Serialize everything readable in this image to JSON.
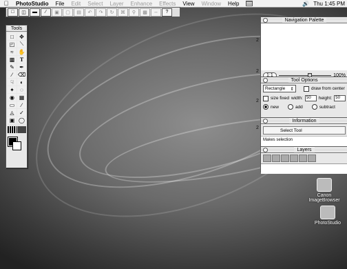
{
  "menubar": {
    "apple": "",
    "app_name": "PhotoStudio",
    "items": [
      {
        "label": "File",
        "enabled": true
      },
      {
        "label": "Edit",
        "enabled": false
      },
      {
        "label": "Select",
        "enabled": false
      },
      {
        "label": "Layer",
        "enabled": false
      },
      {
        "label": "Enhance",
        "enabled": false
      },
      {
        "label": "Effects",
        "enabled": false
      },
      {
        "label": "View",
        "enabled": true
      },
      {
        "label": "Window",
        "enabled": false
      },
      {
        "label": "Help",
        "enabled": true
      }
    ],
    "volume_icon": "speaker-icon",
    "clock": "Thu 1:45 PM"
  },
  "tools_palette": {
    "title": "Tools"
  },
  "toolbar": {
    "help_glyph": "?"
  },
  "navigation_palette": {
    "title": "Navigation Palette",
    "zoom_button": "1:1",
    "zoom_percent": "100%"
  },
  "tool_options": {
    "title": "Tool Options",
    "shape_select": "Rectangle",
    "draw_from_center": "draw from center",
    "size_fixed": "size fixed",
    "width_label": "width:",
    "width_value": "50",
    "height_label": "height:",
    "height_value": "50",
    "mode_new": "new",
    "mode_add": "add",
    "mode_subtract": "subtract"
  },
  "information": {
    "title": "Information",
    "button": "Select Tool",
    "status": "Makes selection"
  },
  "layers": {
    "title": "Layers"
  },
  "desktop_icons": [
    {
      "label": "Canon ImageBrowser"
    },
    {
      "label": "PhotoStudio"
    }
  ],
  "side_marks": [
    "2",
    "2",
    "2",
    "2"
  ],
  "colors": {
    "menubar": "#f2f2f2",
    "desktop": "#6a6a6a"
  }
}
